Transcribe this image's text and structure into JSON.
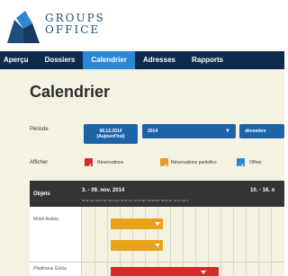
{
  "app": {
    "logo_line1": "GROUPS",
    "logo_line2": "OFFICE",
    "accent": "#2c87d6",
    "nav_bg": "#0f2a4c"
  },
  "nav": {
    "items": [
      {
        "label": "Aperçu"
      },
      {
        "label": "Dossiers"
      },
      {
        "label": "Calendrier",
        "active": true
      },
      {
        "label": "Adresses"
      },
      {
        "label": "Rapports"
      }
    ]
  },
  "page": {
    "title": "Calendrier"
  },
  "period": {
    "label": "Période",
    "date_line1": "08.12.2014",
    "date_line2": "(Aujourd'hui)",
    "year": "2014",
    "month": "décembre"
  },
  "show": {
    "label": "Afficher",
    "options": [
      {
        "label": "Réservations",
        "color": "#d62a2a",
        "checked": true
      },
      {
        "label": "Réservations partielles",
        "color": "#e89a1c",
        "checked": true
      },
      {
        "label": "Offres",
        "color": "#2c87d6",
        "checked": true
      }
    ]
  },
  "calendar": {
    "objects_header": "Objets",
    "week1": "3. - 09. nov. 2014",
    "week2": "10. - 16. n",
    "day_labels": "03.11 mar. 04.11 mer. 05.11 jeu. 06.11 ven. 07.11 sam. 08.11 dim. 09.11 lun. 10.11 mar. 1",
    "rows": [
      {
        "label": "Motel Arabia"
      },
      {
        "label": "Pfadihaus Gloria"
      }
    ],
    "reservation_colors": {
      "partial": "#e8a21c",
      "full": "#d62a2a"
    }
  }
}
